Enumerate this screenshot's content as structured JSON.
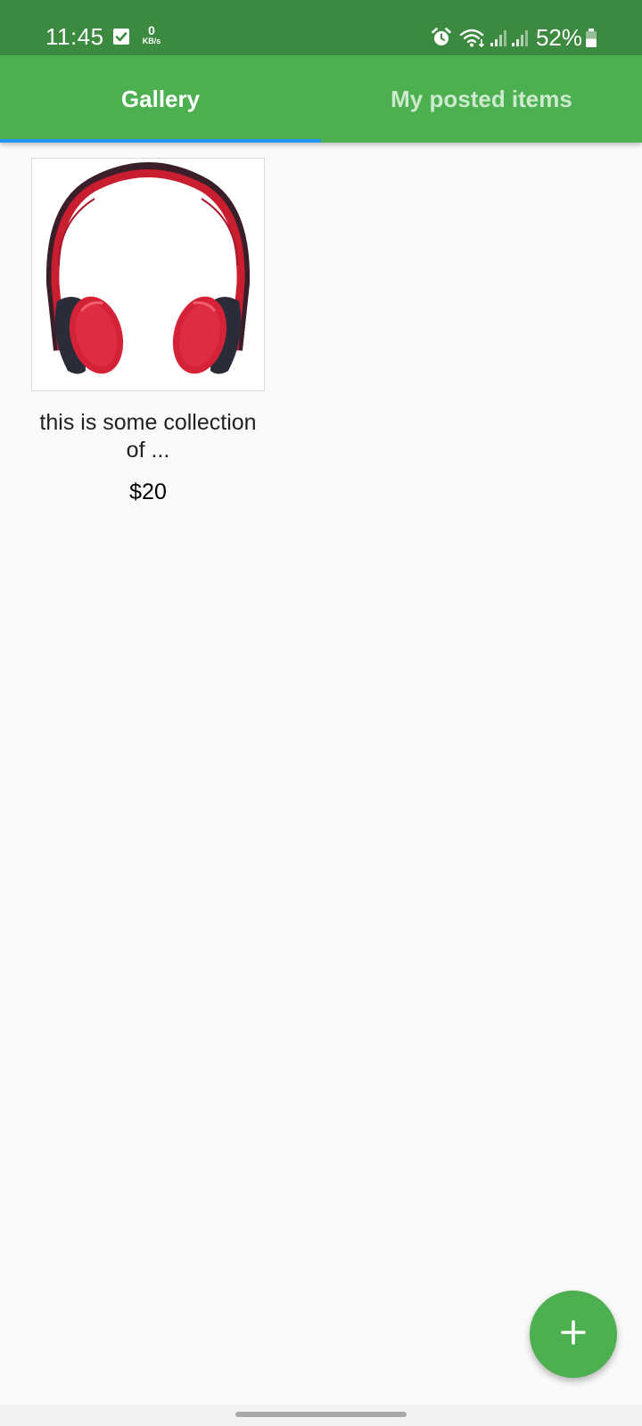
{
  "status_bar": {
    "time": "11:45",
    "net_speed_value": "0",
    "net_speed_unit": "KB/s",
    "battery_percent": "52%",
    "icons": [
      "check-box-icon",
      "alarm-icon",
      "wifi-icon",
      "signal-1-icon",
      "signal-2-icon",
      "battery-icon"
    ]
  },
  "tabs": [
    {
      "label": "Gallery",
      "active": true
    },
    {
      "label": "My posted items",
      "active": false
    }
  ],
  "items": [
    {
      "image": "red-headphones",
      "title": "this is some collection of ...",
      "price": "$20"
    }
  ],
  "fab": {
    "icon": "plus-icon"
  },
  "colors": {
    "status_bar": "#3c8a40",
    "app_bar": "#4caf50",
    "tab_indicator": "#2196f3",
    "fab": "#4caf50",
    "background": "#fafafa"
  }
}
